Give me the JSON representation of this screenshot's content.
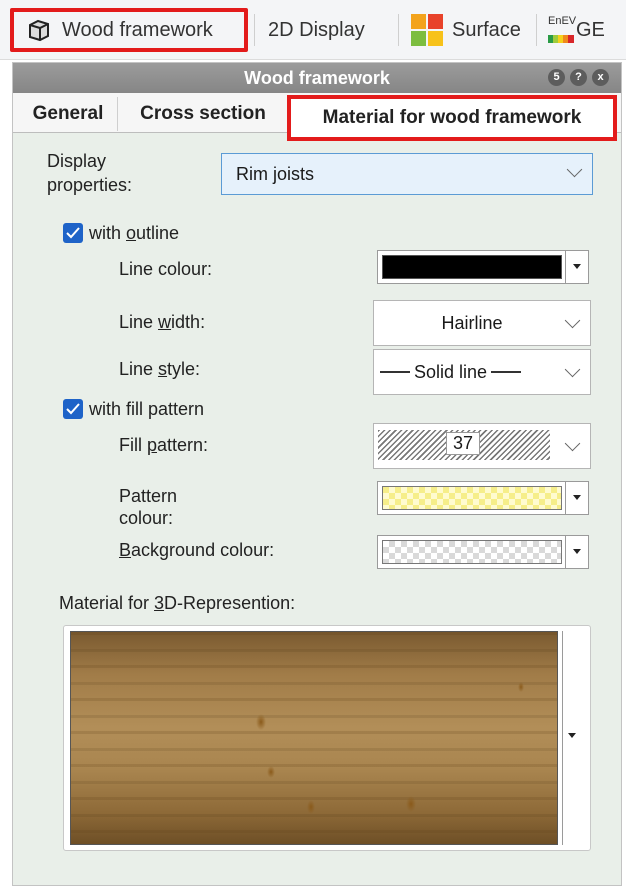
{
  "ribbon": {
    "tab_wood": "Wood framework",
    "tab_2d": "2D Display",
    "tab_surface": "Surface",
    "tab_enev_small": "EnEV",
    "tab_enev_cut": "GE"
  },
  "dialog": {
    "title": "Wood framework",
    "title_buttons": [
      "5",
      "?",
      "x"
    ]
  },
  "tabs": {
    "general": "General",
    "cross_section": "Cross section",
    "material": "Material for wood framework"
  },
  "display_properties": {
    "label_line1": "Display",
    "label_line2": "properties:",
    "value": "Rim joists"
  },
  "outline": {
    "checkbox_pre": "with ",
    "checkbox_u": "o",
    "checkbox_post": "utline",
    "checked": true,
    "line_colour_label": "Line colour:",
    "line_colour_value": "#000000",
    "line_width_pre": "Line ",
    "line_width_u": "w",
    "line_width_post": "idth:",
    "line_width_value": "Hairline",
    "line_style_pre": "Line ",
    "line_style_u": "s",
    "line_style_post": "tyle:",
    "line_style_value": "Solid line"
  },
  "fill": {
    "checkbox_label": "with fill pattern",
    "checked": true,
    "fill_pattern_pre": "Fill ",
    "fill_pattern_u": "p",
    "fill_pattern_post": "attern:",
    "fill_pattern_value": "37",
    "pattern_colour_line1": "Pattern",
    "pattern_colour_line2": "colour:",
    "pattern_colour_value": "#f6ee8a",
    "background_colour_u": "B",
    "background_colour_post": "ackground colour:"
  },
  "material3d": {
    "label_pre": "Material for ",
    "label_u": "3",
    "label_post": "D-Represention:"
  },
  "colors": {
    "accent_red": "#e31b1b",
    "checkbox_blue": "#1e63c8",
    "dialog_bg": "#e9efe9",
    "title_bar": "#8f8f8f"
  }
}
